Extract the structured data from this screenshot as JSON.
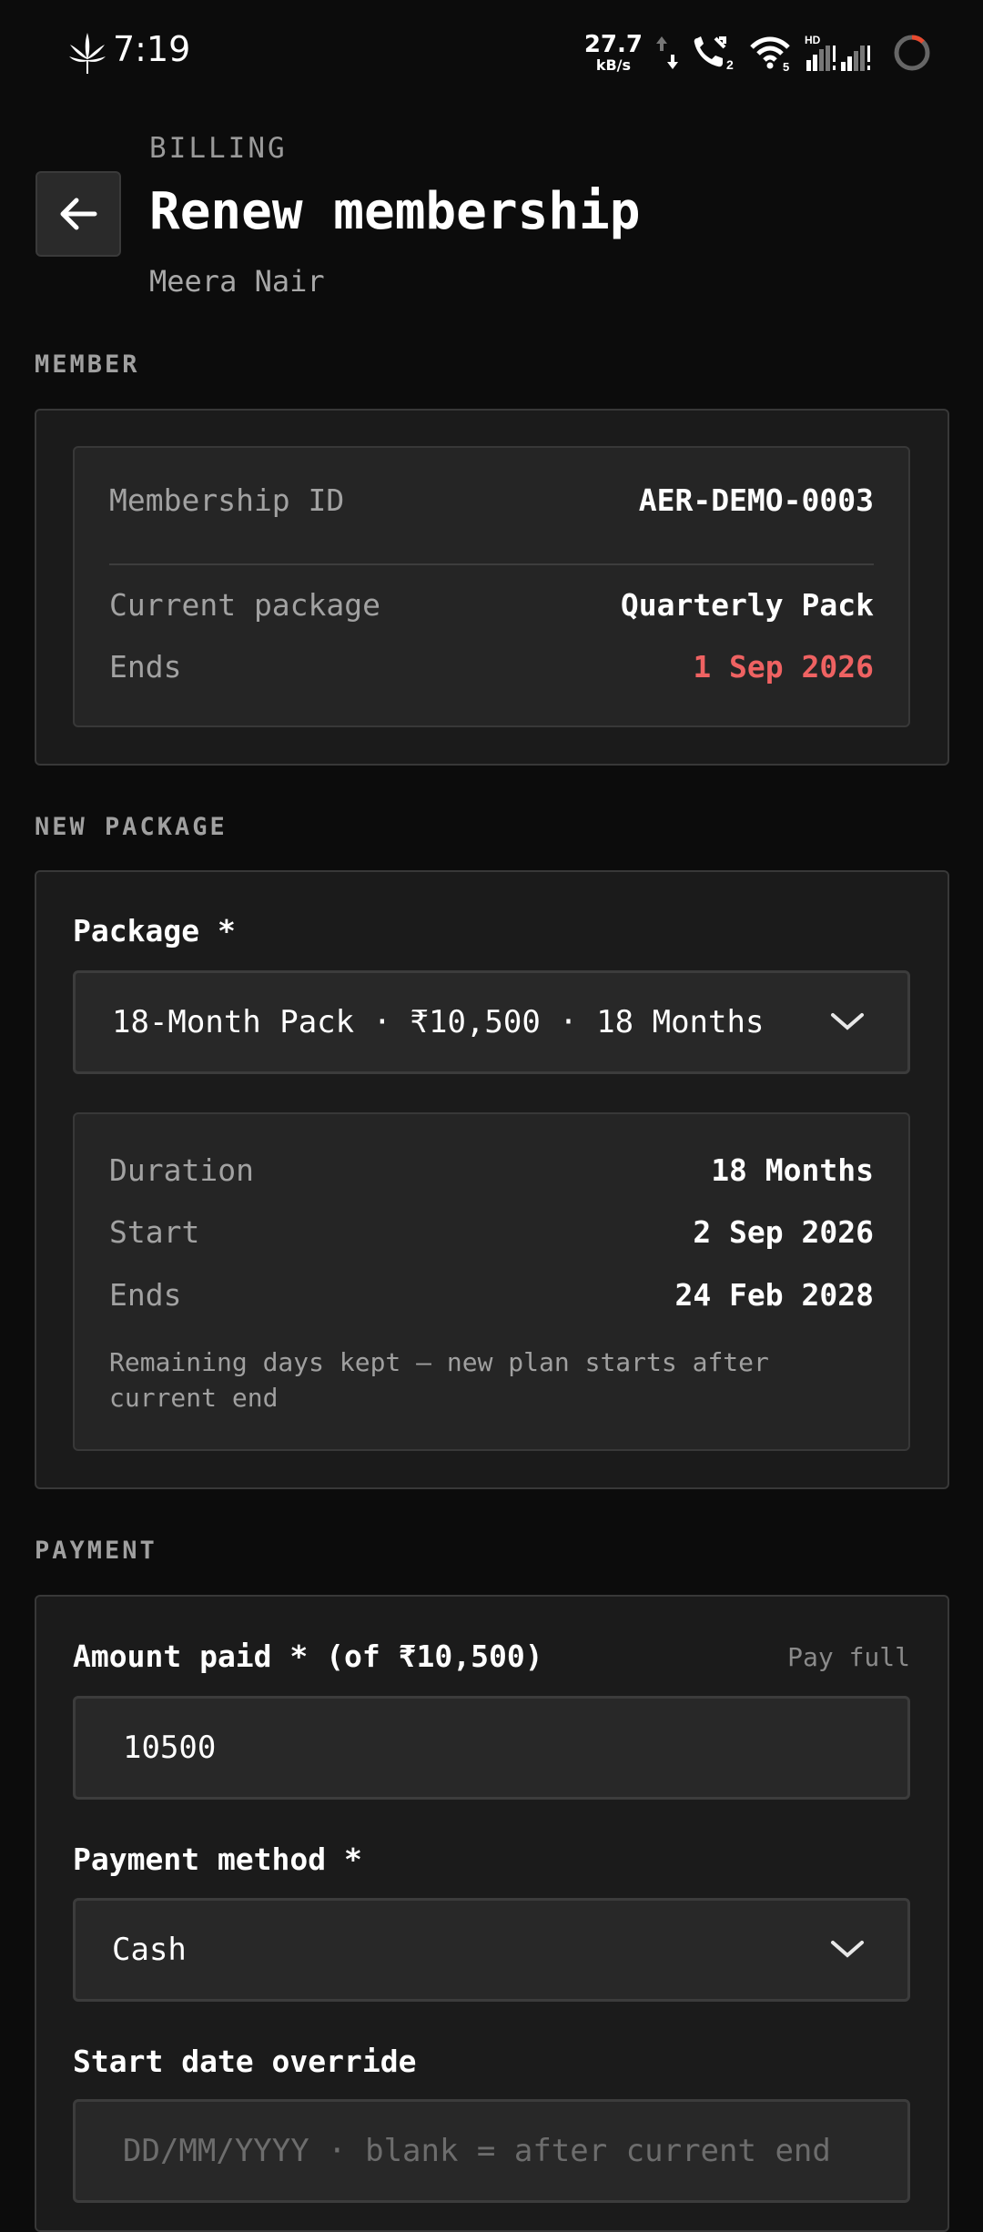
{
  "status_bar": {
    "time": "7:19",
    "net_speed": "27.7",
    "net_unit": "kB/s",
    "icons": [
      "cannabis-leaf-icon",
      "data-arrows-icon",
      "wifi-call-icon",
      "wifi-icon",
      "signal-icon",
      "battery-ring-icon"
    ]
  },
  "header": {
    "eyebrow": "BILLING",
    "title": "Renew membership",
    "subtitle": "Meera Nair"
  },
  "member": {
    "section": "MEMBER",
    "id_label": "Membership ID",
    "id_value": "AER-DEMO-0003",
    "package_label": "Current package",
    "package_value": "Quarterly Pack",
    "ends_label": "Ends",
    "ends_value": "1 Sep 2026",
    "ends_color": "#ef6262"
  },
  "new_package": {
    "section": "NEW PACKAGE",
    "package_label": "Package *",
    "package_selected": "18-Month Pack · ₹10,500 · 18 Months",
    "duration_label": "Duration",
    "duration_value": "18 Months",
    "start_label": "Start",
    "start_value": "2 Sep 2026",
    "ends_label": "Ends",
    "ends_value": "24 Feb 2028",
    "note": "Remaining days kept — new plan starts after current end"
  },
  "payment": {
    "section": "PAYMENT",
    "amount_label": "Amount paid * (of ₹10,500)",
    "pay_full": "Pay full",
    "amount_value": "10500",
    "method_label": "Payment method *",
    "method_selected": "Cash",
    "start_override_label": "Start date override",
    "start_override_placeholder": "DD/MM/YYYY · blank = after current end"
  }
}
